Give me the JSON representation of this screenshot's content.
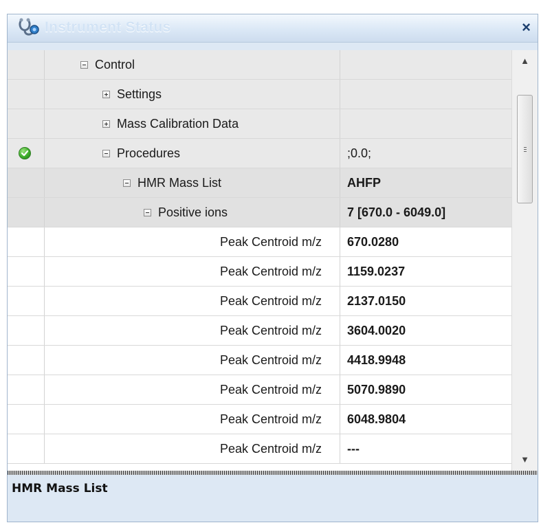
{
  "window": {
    "title": "Instrument Status",
    "close_glyph": "×",
    "icon": "stethoscope-icon"
  },
  "grid": {
    "rows": [
      {
        "label": "Control",
        "expander": "minus",
        "value": ""
      },
      {
        "label": "Settings",
        "expander": "plus",
        "value": ""
      },
      {
        "label": "Mass Calibration Data",
        "expander": "plus",
        "value": ""
      },
      {
        "label": "Procedures",
        "expander": "minus",
        "value": ";0.0;",
        "status_icon": "check-icon"
      },
      {
        "label": "HMR Mass List",
        "expander": "minus",
        "value": "AHFP"
      },
      {
        "label": "Positive ions",
        "expander": "minus",
        "value": "7 [670.0 - 6049.0]"
      },
      {
        "label": "Peak Centroid m/z",
        "value": "670.0280"
      },
      {
        "label": "Peak Centroid m/z",
        "value": "1159.0237"
      },
      {
        "label": "Peak Centroid m/z",
        "value": "2137.0150"
      },
      {
        "label": "Peak Centroid m/z",
        "value": "3604.0020"
      },
      {
        "label": "Peak Centroid m/z",
        "value": "4418.9948"
      },
      {
        "label": "Peak Centroid m/z",
        "value": "5070.9890"
      },
      {
        "label": "Peak Centroid m/z",
        "value": "6048.9804"
      },
      {
        "label": "Peak Centroid m/z",
        "value": "---"
      }
    ]
  },
  "scrollbar": {
    "up_glyph": "▲",
    "down_glyph": "▼"
  },
  "description": {
    "title": "HMR Mass List"
  },
  "colors": {
    "check": "#3eae2a",
    "title_text": "#d2e3f5",
    "close": "#1c3f6e"
  }
}
